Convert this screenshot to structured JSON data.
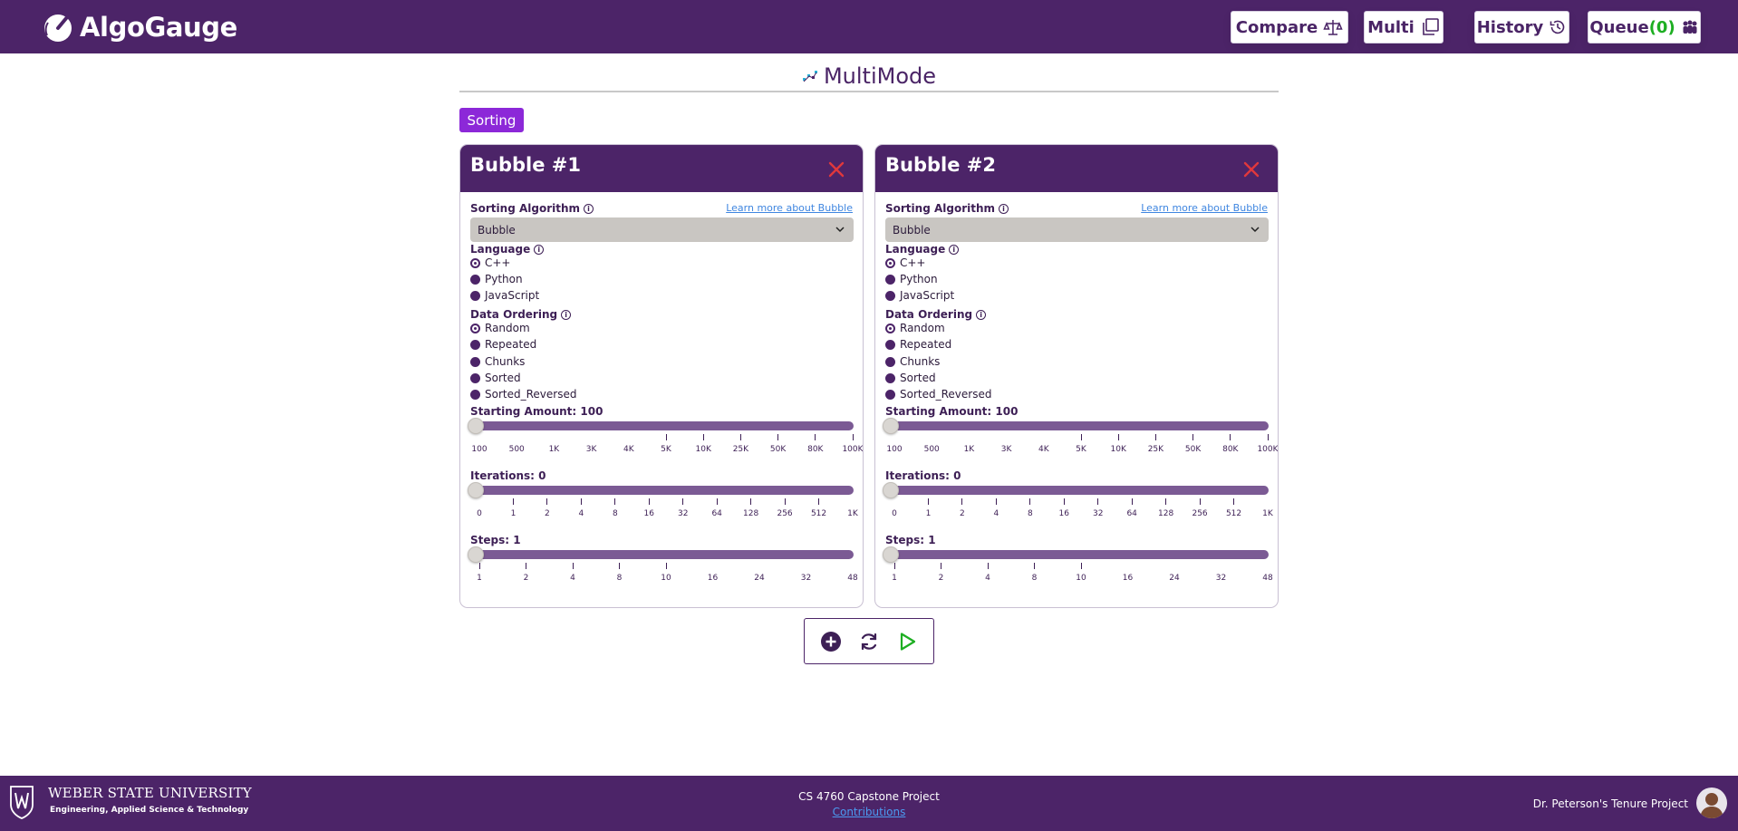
{
  "app": {
    "name": "AlgoGauge"
  },
  "nav": {
    "compare": "Compare",
    "multi": "Multi",
    "history": "History",
    "queue_label": "Queue",
    "queue_count": "(0)"
  },
  "page": {
    "title": "MultiMode",
    "category_tag": "Sorting"
  },
  "cards": [
    {
      "title": "Bubble #1",
      "sorting_algorithm_label": "Sorting Algorithm",
      "learn_more": "Learn more about Bubble",
      "selected_algorithm": "Bubble",
      "language_label": "Language",
      "languages": [
        "C++",
        "Python",
        "JavaScript"
      ],
      "selected_language": "C++",
      "ordering_label": "Data Ordering",
      "orderings": [
        "Random",
        "Repeated",
        "Chunks",
        "Sorted",
        "Sorted_Reversed"
      ],
      "selected_ordering": "Random",
      "starting_amount_label": "Starting Amount: 100",
      "starting_amount_ticks": [
        "100",
        "500",
        "1K",
        "3K",
        "4K",
        "5K",
        "10K",
        "25K",
        "50K",
        "80K",
        "100K"
      ],
      "iterations_label": "Iterations: 0",
      "iterations_ticks": [
        "0",
        "1",
        "2",
        "4",
        "8",
        "16",
        "32",
        "64",
        "128",
        "256",
        "512",
        "1K"
      ],
      "steps_label": "Steps: 1",
      "steps_ticks": [
        "1",
        "2",
        "4",
        "8",
        "10",
        "16",
        "24",
        "32",
        "48"
      ]
    },
    {
      "title": "Bubble #2",
      "sorting_algorithm_label": "Sorting Algorithm",
      "learn_more": "Learn more about Bubble",
      "selected_algorithm": "Bubble",
      "language_label": "Language",
      "languages": [
        "C++",
        "Python",
        "JavaScript"
      ],
      "selected_language": "C++",
      "ordering_label": "Data Ordering",
      "orderings": [
        "Random",
        "Repeated",
        "Chunks",
        "Sorted",
        "Sorted_Reversed"
      ],
      "selected_ordering": "Random",
      "starting_amount_label": "Starting Amount: 100",
      "starting_amount_ticks": [
        "100",
        "500",
        "1K",
        "3K",
        "4K",
        "5K",
        "10K",
        "25K",
        "50K",
        "80K",
        "100K"
      ],
      "iterations_label": "Iterations: 0",
      "iterations_ticks": [
        "0",
        "1",
        "2",
        "4",
        "8",
        "16",
        "32",
        "64",
        "128",
        "256",
        "512",
        "1K"
      ],
      "steps_label": "Steps: 1",
      "steps_ticks": [
        "1",
        "2",
        "4",
        "8",
        "10",
        "16",
        "24",
        "32",
        "48"
      ]
    }
  ],
  "controls": {
    "add_icon": "plus-circle-icon",
    "reset_icon": "refresh-icon",
    "run_icon": "play-icon"
  },
  "footer": {
    "university_name": "WEBER STATE UNIVERSITY",
    "college": "Engineering, Applied Science & Technology",
    "project_title": "CS 4760 Capstone Project",
    "contributions_link": "Contributions",
    "tenure": "Dr. Peterson's Tenure Project"
  },
  "colors": {
    "brand_purple": "#4c2468",
    "accent_violet": "#8c28d8",
    "close_red": "#e0383c",
    "run_green": "#1dae22",
    "link_blue": "#3f86e0"
  }
}
